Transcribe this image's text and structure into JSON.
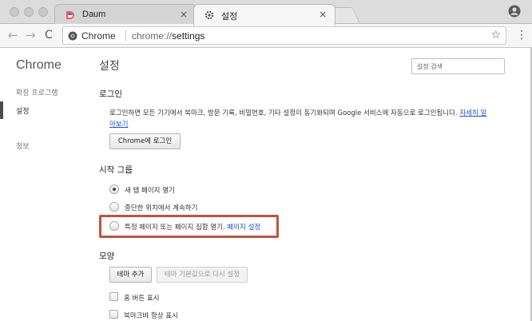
{
  "tabs": [
    {
      "title": "Daum",
      "close": "×"
    },
    {
      "title": "설정",
      "close": "×"
    }
  ],
  "toolbar": {
    "back": "←",
    "forward": "→",
    "reload": "C",
    "omnibox_label": "Chrome",
    "url_prefix": "chrome://",
    "url_path": "settings",
    "star": "☆",
    "menu": "⋮"
  },
  "sidebar": {
    "title": "Chrome",
    "items": [
      {
        "label": "확장 프로그램"
      },
      {
        "label": "설정"
      },
      {
        "label": "정보"
      }
    ]
  },
  "main": {
    "title": "설정",
    "search_placeholder": "설정 검색",
    "login": {
      "heading": "로그인",
      "description": "로그인하면 모든 기기에서 북마크, 방문 기록, 비밀번호, 기타 설정이 동기화되며 Google 서비스에 자동으로 로그인됩니다. ",
      "link": "자세히 알아보기",
      "button": "Chrome에 로그인"
    },
    "startup": {
      "heading": "시작 그룹",
      "options": [
        {
          "label": "새 탭 페이지 열기"
        },
        {
          "label": "중단한 위치에서 계속하기"
        },
        {
          "label": "특정 페이지 또는 페이지 집합 열기.",
          "link": "페이지 설정"
        }
      ]
    },
    "appearance": {
      "heading": "모양",
      "theme_button": "테마 추가",
      "reset_button": "테마 기본값으로 다시 설정",
      "checkboxes": [
        {
          "label": "홈 버튼 표시"
        },
        {
          "label": "북마크바 항상 표시"
        }
      ]
    }
  },
  "colors": {
    "highlight": "#c0533c",
    "link": "#1a4fd6"
  }
}
